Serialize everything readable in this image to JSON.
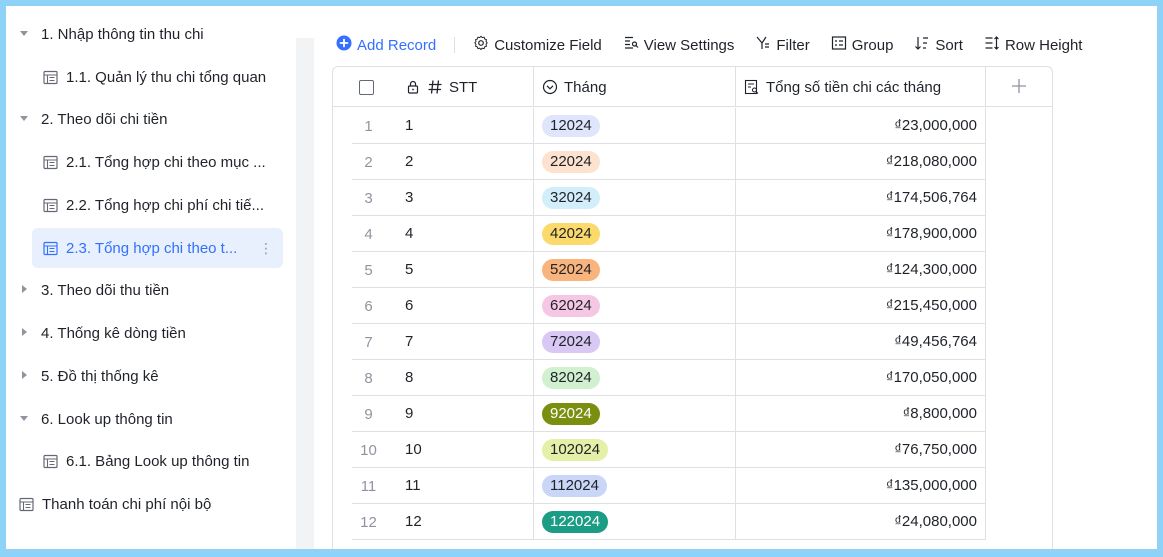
{
  "sidebar": {
    "items": [
      {
        "label": "1. Nhập thông tin thu chi",
        "type": "folder",
        "expanded": true
      },
      {
        "label": "1.1. Quản lý thu chi tổng quan",
        "type": "table"
      },
      {
        "label": "2. Theo dõi chi tiền",
        "type": "folder",
        "expanded": true
      },
      {
        "label": "2.1. Tổng hợp chi theo mục ...",
        "type": "table"
      },
      {
        "label": "2.2. Tổng hợp chi phí chi tiế...",
        "type": "table"
      },
      {
        "label": "2.3. Tổng hợp chi theo t...",
        "type": "table",
        "active": true
      },
      {
        "label": "3. Theo dõi thu tiền",
        "type": "folder",
        "expanded": false
      },
      {
        "label": "4. Thống kê dòng tiền",
        "type": "folder",
        "expanded": false
      },
      {
        "label": "5. Đồ thị thống kê",
        "type": "folder",
        "expanded": false
      },
      {
        "label": "6. Look up thông tin",
        "type": "folder",
        "expanded": true
      },
      {
        "label": "6.1. Bảng Look up thông tin",
        "type": "table"
      },
      {
        "label": "Thanh toán chi phí nội bộ",
        "type": "table"
      }
    ],
    "more_icon": "⋮"
  },
  "toolbar": {
    "add_record": "Add Record",
    "customize_field": "Customize Field",
    "view_settings": "View Settings",
    "filter": "Filter",
    "group": "Group",
    "sort": "Sort",
    "row_height": "Row Height"
  },
  "grid": {
    "columns": {
      "stt": "STT",
      "month": "Tháng",
      "total": "Tổng số tiền chi các tháng"
    },
    "rows": [
      {
        "index": "1",
        "stt": "1",
        "month": "12024",
        "total": "₫23,000,000",
        "tag_bg": "#dfe6fb",
        "tag_fg": "#1f2329"
      },
      {
        "index": "2",
        "stt": "2",
        "month": "22024",
        "total": "₫218,080,000",
        "tag_bg": "#fde2cf",
        "tag_fg": "#1f2329"
      },
      {
        "index": "3",
        "stt": "3",
        "month": "32024",
        "total": "₫174,506,764",
        "tag_bg": "#d3eefb",
        "tag_fg": "#1f2329"
      },
      {
        "index": "4",
        "stt": "4",
        "month": "42024",
        "total": "₫178,900,000",
        "tag_bg": "#fbd96b",
        "tag_fg": "#1f2329"
      },
      {
        "index": "5",
        "stt": "5",
        "month": "52024",
        "total": "₫124,300,000",
        "tag_bg": "#f9b37c",
        "tag_fg": "#1f2329"
      },
      {
        "index": "6",
        "stt": "6",
        "month": "62024",
        "total": "₫215,450,000",
        "tag_bg": "#f6c7e4",
        "tag_fg": "#1f2329"
      },
      {
        "index": "7",
        "stt": "7",
        "month": "72024",
        "total": "₫49,456,764",
        "tag_bg": "#d9c7f4",
        "tag_fg": "#1f2329"
      },
      {
        "index": "8",
        "stt": "8",
        "month": "82024",
        "total": "₫170,050,000",
        "tag_bg": "#d1f0cf",
        "tag_fg": "#1f2329"
      },
      {
        "index": "9",
        "stt": "9",
        "month": "92024",
        "total": "₫8,800,000",
        "tag_bg": "#7a8f10",
        "tag_fg": "#ffffff"
      },
      {
        "index": "10",
        "stt": "10",
        "month": "102024",
        "total": "₫76,750,000",
        "tag_bg": "#e4f0a8",
        "tag_fg": "#1f2329"
      },
      {
        "index": "11",
        "stt": "11",
        "month": "112024",
        "total": "₫135,000,000",
        "tag_bg": "#c9d6f8",
        "tag_fg": "#1f2329"
      },
      {
        "index": "12",
        "stt": "12",
        "month": "122024",
        "total": "₫24,080,000",
        "tag_bg": "#1a9c85",
        "tag_fg": "#ffffff"
      }
    ]
  },
  "colors": {
    "accent": "#3370ff",
    "active_bg": "#e8f0fe",
    "border": "#dee0e3",
    "frame": "#8ed3f7"
  }
}
